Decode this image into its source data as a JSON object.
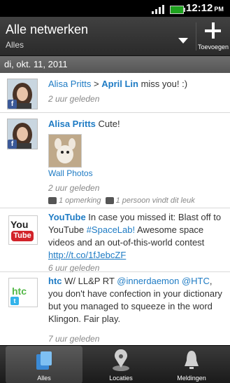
{
  "status": {
    "time": "12:12",
    "ampm": "PM"
  },
  "action_bar": {
    "title": "Alle netwerken",
    "subtitle": "Alles",
    "add_label": "Toevoegen"
  },
  "date_header": "di, okt. 11, 2011",
  "feed": [
    {
      "name": "Alisa Pritts",
      "arrow": " > ",
      "target": "April Lin",
      "text": " miss you! :)",
      "time": "2 uur geleden"
    },
    {
      "name": "Alisa Pritts",
      "text": " Cute!",
      "photo_caption": "Wall Photos",
      "time": "2 uur geleden",
      "comments": "1 opmerking",
      "likes": "1 persoon vindt dit leuk"
    },
    {
      "name": "YouTube",
      "text_a": " In case you missed it: Blast off to YouTube ",
      "hashtag": "#SpaceLab!",
      "text_b": " Awesome space videos and an out-of-this-world contest ",
      "link": "http://t.co/1fJebcZF",
      "time": "6 uur geleden"
    },
    {
      "name": "htc",
      "text_a": " W/ LL&P RT ",
      "mention1": "@innerdaemon",
      "mention2": " @HTC",
      "text_b": ", you don't have confection in your dictionary but you managed to squeeze in the word Klingon. Fair play.",
      "time": "7 uur geleden"
    }
  ],
  "tabs": [
    {
      "label": "Alles",
      "icon": "all-icon",
      "active": true
    },
    {
      "label": "Locaties",
      "icon": "location-pin-icon",
      "active": false
    },
    {
      "label": "Meldingen",
      "icon": "bell-icon",
      "active": false
    }
  ]
}
